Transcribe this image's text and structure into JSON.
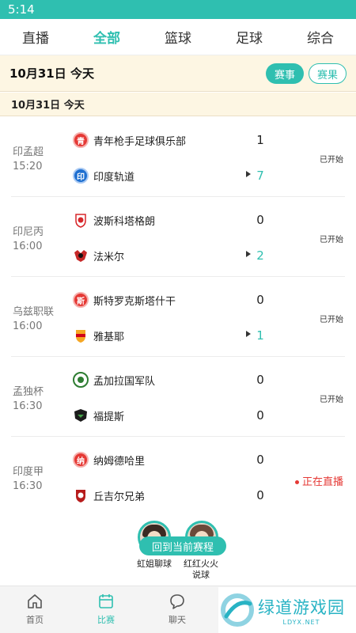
{
  "status_bar": {
    "time": "5:14"
  },
  "tabs": [
    {
      "label": "直播"
    },
    {
      "label": "全部"
    },
    {
      "label": "篮球"
    },
    {
      "label": "足球"
    },
    {
      "label": "综合"
    }
  ],
  "date_bar": {
    "date": "10月31日  今天",
    "events_label": "赛事",
    "results_label": "赛果"
  },
  "sub_bar": {
    "date": "10月31日    今天"
  },
  "matches": [
    {
      "league": "印孟超",
      "time": "15:20",
      "home": "青年枪手足球俱乐部",
      "home_logo": "青",
      "away": "印度轨道",
      "away_logo": "印",
      "home_score": "1",
      "away_score": "7",
      "status": "已开始"
    },
    {
      "league": "印尼丙",
      "time": "16:00",
      "home": "波斯科塔格朗",
      "away": "法米尔",
      "home_score": "0",
      "away_score": "2",
      "status": "已开始"
    },
    {
      "league": "乌兹职联",
      "time": "16:00",
      "home": "斯特罗克斯塔什干",
      "home_logo": "斯",
      "away": "雅基耶",
      "home_score": "0",
      "away_score": "1",
      "status": "已开始"
    },
    {
      "league": "孟独杯",
      "time": "16:30",
      "home": "孟加拉国军队",
      "away": "福提斯",
      "home_score": "0",
      "away_score": "0",
      "status": "已开始"
    },
    {
      "league": "印度甲",
      "time": "16:30",
      "home": "纳姆德哈里",
      "home_logo": "纳",
      "away": "丘吉尔兄弟",
      "home_score": "0",
      "away_score": "0",
      "status": "正在直播"
    }
  ],
  "float_panel": {
    "button_label": "回到当前赛程",
    "anchor1": "虹姐聊球",
    "anchor2": "红红火火\n说球"
  },
  "bottom_nav": [
    {
      "label": "首页"
    },
    {
      "label": "比赛"
    },
    {
      "label": "聊天"
    }
  ],
  "watermark": {
    "title": "绿道游戏园",
    "subtitle": "LDYX.NET"
  },
  "colors": {
    "accent": "#2fbfb0",
    "live": "#e53935",
    "date_bar_bg": "#fdf6e3"
  }
}
